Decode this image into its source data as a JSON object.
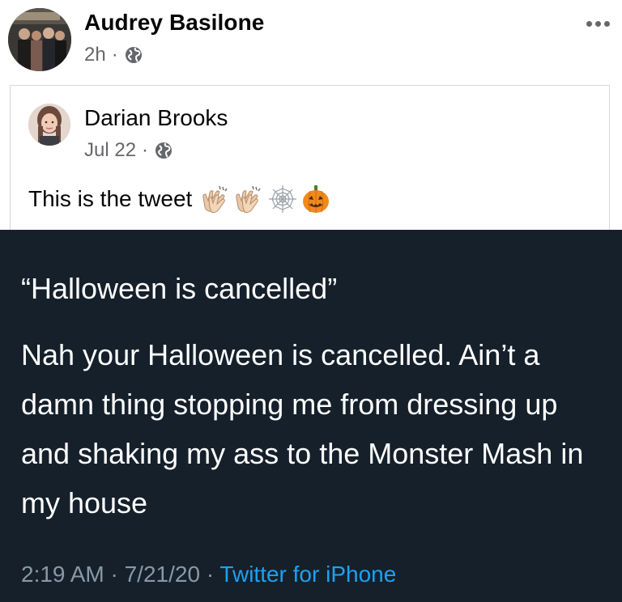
{
  "post": {
    "author": "Audrey Basilone",
    "time": "2h",
    "separator": "·",
    "privacy_icon": "globe-icon",
    "more_icon": "more-options-icon"
  },
  "shared_post": {
    "author": "Darian Brooks",
    "time": "Jul 22",
    "separator": "·",
    "privacy_icon": "globe-icon",
    "text": "This is the tweet",
    "emojis": [
      "clapping-hands-emoji",
      "clapping-hands-emoji",
      "spider-web-emoji",
      "jack-o-lantern-emoji"
    ]
  },
  "tweet": {
    "quote": "“Halloween is cancelled”",
    "body": "Nah your Halloween is cancelled. Ain’t a damn thing stopping me from dressing up and shaking my ass to the Monster Mash in my house",
    "timestamp": "2:19 AM · 7/21/20 · ",
    "source": "Twitter for iPhone",
    "colors": {
      "background": "#15202b",
      "text": "#ffffff",
      "meta": "#8899a6",
      "link": "#1da1f2"
    }
  }
}
